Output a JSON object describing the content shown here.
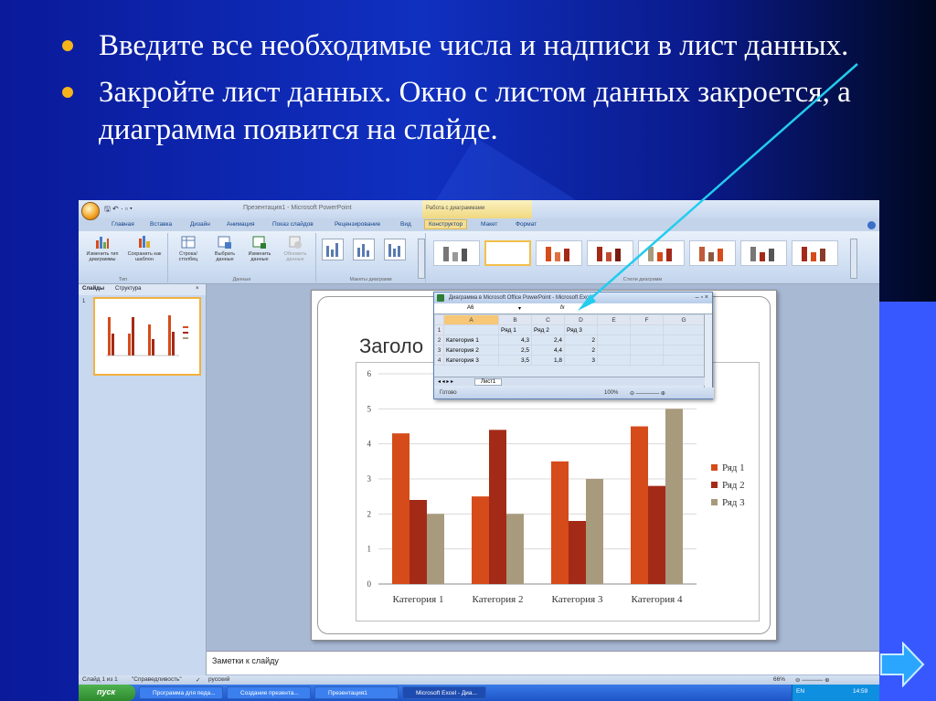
{
  "slide": {
    "bullets": [
      "Введите все необходимые числа и надписи в лист данных.",
      "Закройте лист данных. Окно с листом данных закроется, а диаграмма появится на слайде."
    ],
    "bullet_color": "#f5b51a"
  },
  "app": {
    "qat": "🖫 ↶ · ▫ ▾",
    "window_title": "Презентация1 - Microsoft PowerPoint",
    "context_title": "Работа с диаграммами",
    "tabs": [
      "Главная",
      "Вставка",
      "Дизайн",
      "Анимация",
      "Показ слайдов",
      "Рецензирование",
      "Вид",
      "Конструктор",
      "Макет",
      "Формат"
    ],
    "ribbon": {
      "type_group": {
        "btn1": "Изменить тип диаграммы",
        "btn2": "Сохранить как шаблон",
        "label": "Тип"
      },
      "data_group": {
        "btn1": "Строка/столбец",
        "btn2": "Выбрать данные",
        "btn3": "Изменить данные",
        "btn4": "Обновить данные",
        "label": "Данные"
      },
      "layouts_label": "Макеты диаграмм",
      "styles_label": "Стили диаграмм"
    },
    "panel_tabs": [
      "Слайды",
      "Структура"
    ],
    "panel_close": "×",
    "slide_number": "1",
    "slide_title_placeholder": "Заголо",
    "notes_placeholder": "Заметки к слайду",
    "status": {
      "slide": "Слайд 1 из 1",
      "theme": "\"Справедливость\"",
      "lang": "русский",
      "zoom": "66%"
    },
    "taskbar": {
      "start": "пуск",
      "buttons": [
        "Программа для педа...",
        "Создание презента...",
        "Презентация1",
        "Microsoft Excel - Диа..."
      ],
      "lang": "EN",
      "time": "14:59"
    }
  },
  "excel": {
    "title": "Диаграмма в Microsoft Office PowerPoint - Microsoft Excel",
    "name_box": "A6",
    "fx": "fx",
    "columns": [
      "",
      "A",
      "B",
      "C",
      "D",
      "E",
      "F",
      "G"
    ],
    "rows": [
      [
        "1",
        "",
        "Ряд 1",
        "Ряд 2",
        "Ряд 3",
        "",
        "",
        ""
      ],
      [
        "2",
        "Категория 1",
        "4,3",
        "2,4",
        "2",
        "",
        "",
        ""
      ],
      [
        "3",
        "Категория 2",
        "2,5",
        "4,4",
        "2",
        "",
        "",
        ""
      ],
      [
        "4",
        "Категория 3",
        "3,5",
        "1,8",
        "3",
        "",
        "",
        ""
      ]
    ],
    "sheet_tab": "Лист1",
    "status_ready": "Готово",
    "status_zoom": "100%"
  },
  "chart_data": {
    "type": "bar",
    "categories": [
      "Категория 1",
      "Категория 2",
      "Категория 3",
      "Категория 4"
    ],
    "series": [
      {
        "name": "Ряд 1",
        "values": [
          4.3,
          2.5,
          3.5,
          4.5
        ],
        "color": "#d64b1a"
      },
      {
        "name": "Ряд 2",
        "values": [
          2.4,
          4.4,
          1.8,
          2.8
        ],
        "color": "#a42a18"
      },
      {
        "name": "Ряд 3",
        "values": [
          2,
          2,
          3,
          5
        ],
        "color": "#a89a7c"
      }
    ],
    "ylim": [
      0,
      6
    ],
    "yticks": [
      0,
      1,
      2,
      3,
      4,
      5,
      6
    ],
    "grid": true,
    "legend": "right"
  },
  "colors": {
    "arrow": "#22ccee",
    "next_button": "#2aa6ff"
  }
}
